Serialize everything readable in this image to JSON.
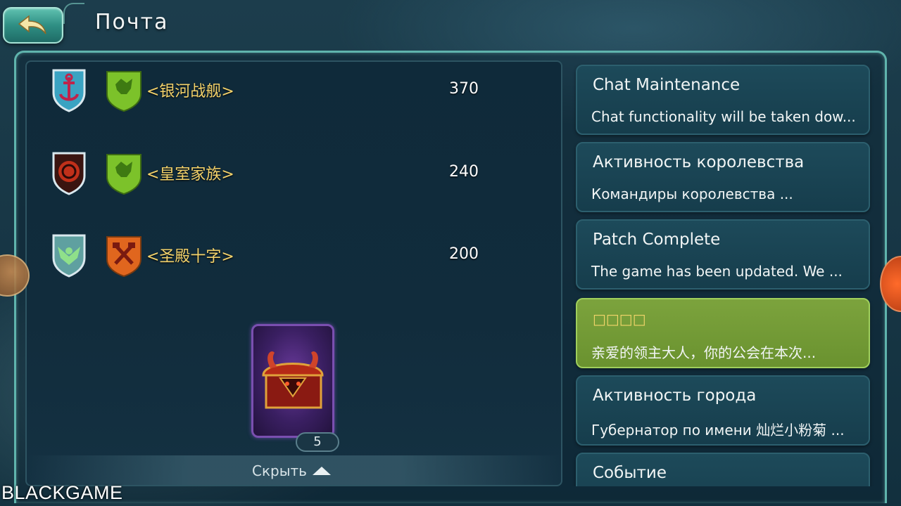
{
  "header": {
    "title": "Почта"
  },
  "rankings": [
    {
      "guild": "<银河战舰>",
      "score": "370",
      "emblem_icon": "anchor-shield-icon",
      "guild_icon": "green-beast-shield-icon"
    },
    {
      "guild": "<皇室家族>",
      "score": "240",
      "emblem_icon": "red-dragon-shield-icon",
      "guild_icon": "green-beast-shield-icon"
    },
    {
      "guild": "<圣殿十字>",
      "score": "200",
      "emblem_icon": "green-eagle-shield-icon",
      "guild_icon": "orange-hammer-shield-icon"
    }
  ],
  "reward": {
    "icon": "demon-chest-icon",
    "count": "5"
  },
  "hide_label": "Скрыть",
  "mails": [
    {
      "title": "Chat Maintenance",
      "preview": "Chat functionality will be taken dow...",
      "selected": false
    },
    {
      "title": "Активность королевства",
      "preview": "Командиры королевства ...",
      "selected": false
    },
    {
      "title": "Patch Complete",
      "preview": "The game has been updated. We ...",
      "selected": false
    },
    {
      "title": "□□□□",
      "preview": "亲爱的领主大人，你的公会在本次...",
      "selected": true
    },
    {
      "title": "Активность города",
      "preview": "Губернатор по имени 灿烂小粉菊 ...",
      "selected": false
    },
    {
      "title": "Событие",
      "preview": "",
      "selected": false
    }
  ],
  "watermark": "BLACKGAME",
  "colors": {
    "guild_name": "#f3d26b",
    "selected_mail": "#7ca33d",
    "frame_accent": "#5fb4ad"
  }
}
